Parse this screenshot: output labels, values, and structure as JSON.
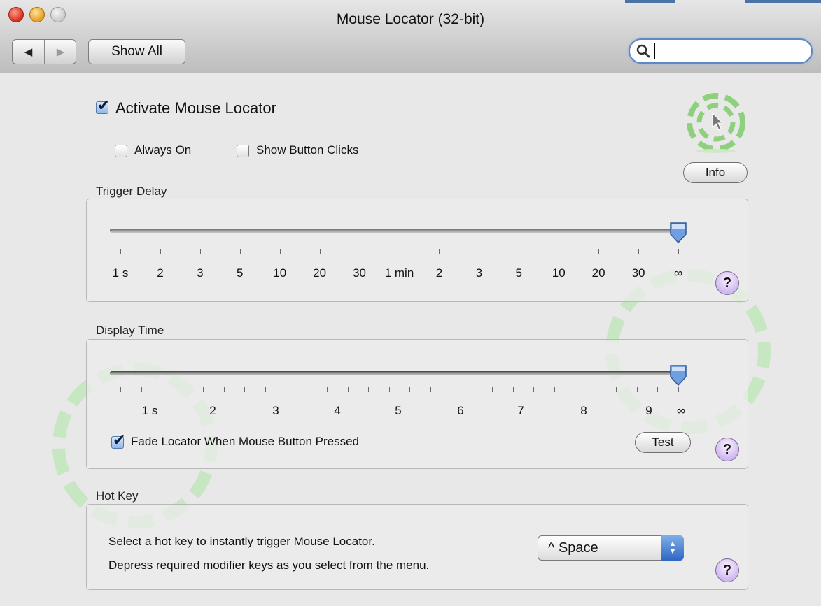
{
  "window": {
    "title": "Mouse Locator (32-bit)"
  },
  "toolbar": {
    "back_label": "◀",
    "forward_label": "▶",
    "show_all_label": "Show All",
    "search_placeholder": "",
    "search_value": ""
  },
  "main": {
    "activate": {
      "label": "Activate Mouse Locator",
      "checked": true
    },
    "always_on": {
      "label": "Always On",
      "checked": false
    },
    "show_clicks": {
      "label": "Show Button Clicks",
      "checked": false
    },
    "info_label": "Info"
  },
  "trigger_delay": {
    "title": "Trigger Delay",
    "ticks": [
      "1 s",
      "2",
      "3",
      "5",
      "10",
      "20",
      "30",
      "1 min",
      "2",
      "3",
      "5",
      "10",
      "20",
      "30",
      "∞"
    ],
    "selected": "∞",
    "help_label": "?"
  },
  "display_time": {
    "title": "Display Time",
    "labels": [
      "1 s",
      "2",
      "3",
      "4",
      "5",
      "6",
      "7",
      "8",
      "9",
      "∞"
    ],
    "selected": "∞",
    "fade": {
      "label": "Fade Locator When Mouse Button Pressed",
      "checked": true
    },
    "test_label": "Test",
    "help_label": "?"
  },
  "hot_key": {
    "title": "Hot Key",
    "line1": "Select a hot key to instantly trigger Mouse Locator.",
    "line2": "Depress required modifier keys as you select from the menu.",
    "selected": "^ Space",
    "help_label": "?"
  },
  "colors": {
    "accent": "#5f86c6",
    "logo_green": "#8fd07f",
    "help_purple": "#cfb7ef"
  }
}
